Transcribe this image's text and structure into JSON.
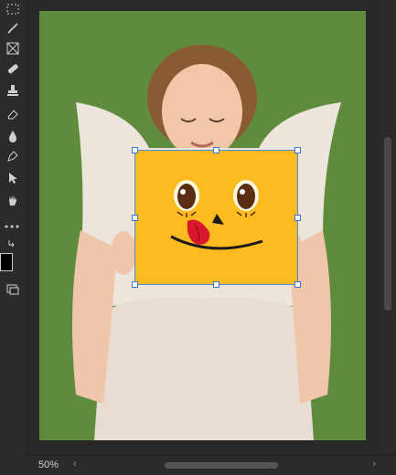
{
  "status": {
    "zoom_label": "50%"
  },
  "toolbar": {
    "tools": [
      "marquee-tool",
      "brush-tool",
      "frame-tool",
      "eraser-tool",
      "stamp-tool",
      "eraser-tool-2",
      "blur-tool",
      "pen-tool",
      "selection-tool",
      "hand-tool"
    ]
  },
  "colors": {
    "background": "#5e8c3c",
    "placed_fill": "#fbbb21",
    "selection": "#4f8ede",
    "foreground_swatch": "#000000"
  },
  "scroll": {
    "left_arrow": "‹",
    "right_arrow": "›"
  }
}
